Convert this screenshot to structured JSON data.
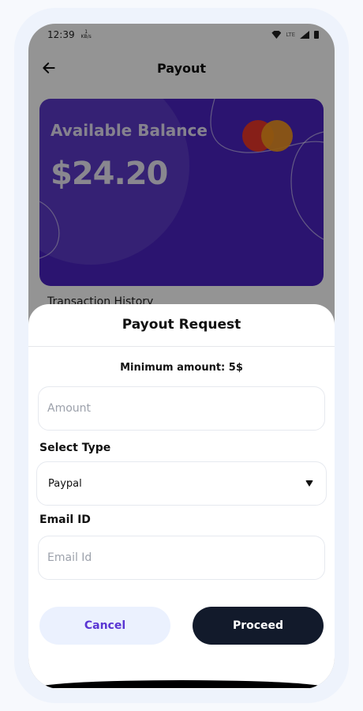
{
  "statusbar": {
    "time": "12:39",
    "net_speed_value": "1",
    "net_speed_unit": "KB/s",
    "lte": "LTE"
  },
  "appbar": {
    "title": "Payout"
  },
  "card": {
    "balance_label": "Available Balance",
    "balance_value": "$24.20"
  },
  "history": {
    "label": "Transaction History"
  },
  "sheet": {
    "title": "Payout Request",
    "min_amount": "Minimum amount: 5$",
    "amount_placeholder": "Amount",
    "select_type_label": "Select Type",
    "selected_type": "Paypal",
    "email_label": "Email ID",
    "email_placeholder": "Email Id",
    "cancel_label": "Cancel",
    "proceed_label": "Proceed"
  },
  "colors": {
    "card": "#4a24c2",
    "accent": "#5a35d3",
    "primary_button": "#121a2b",
    "secondary_button": "#ebf1fe"
  },
  "icons": {
    "back": "arrow-left-icon",
    "dropdown": "caret-down-icon",
    "card_brand": "mastercard-logo"
  }
}
